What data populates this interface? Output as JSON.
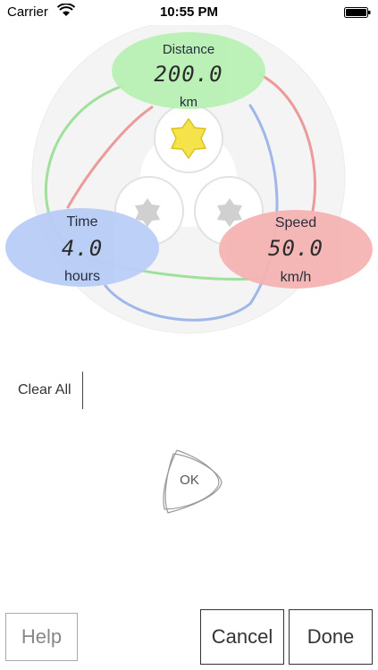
{
  "status_bar": {
    "carrier": "Carrier",
    "time": "10:55 PM",
    "wifi_icon": "wifi-icon",
    "battery_icon": "battery-icon"
  },
  "calculator": {
    "distance": {
      "label": "Distance",
      "value": "200.0",
      "unit": "km",
      "color": "#b8f0b4"
    },
    "time": {
      "label": "Time",
      "value": "4.0",
      "unit": "hours",
      "color": "#b9cdf7"
    },
    "speed": {
      "label": "Speed",
      "value": "50.0",
      "unit": "km/h",
      "color": "#f6b3b3"
    },
    "selected_icon": "star-icon-selected",
    "colors": {
      "green": "#9fe09a",
      "blue": "#9fb7ea",
      "red": "#ec9a9a",
      "star": "#f6e24a"
    }
  },
  "actions": {
    "clear_all": "Clear All",
    "ok": "OK",
    "help": "Help",
    "cancel": "Cancel",
    "done": "Done"
  }
}
